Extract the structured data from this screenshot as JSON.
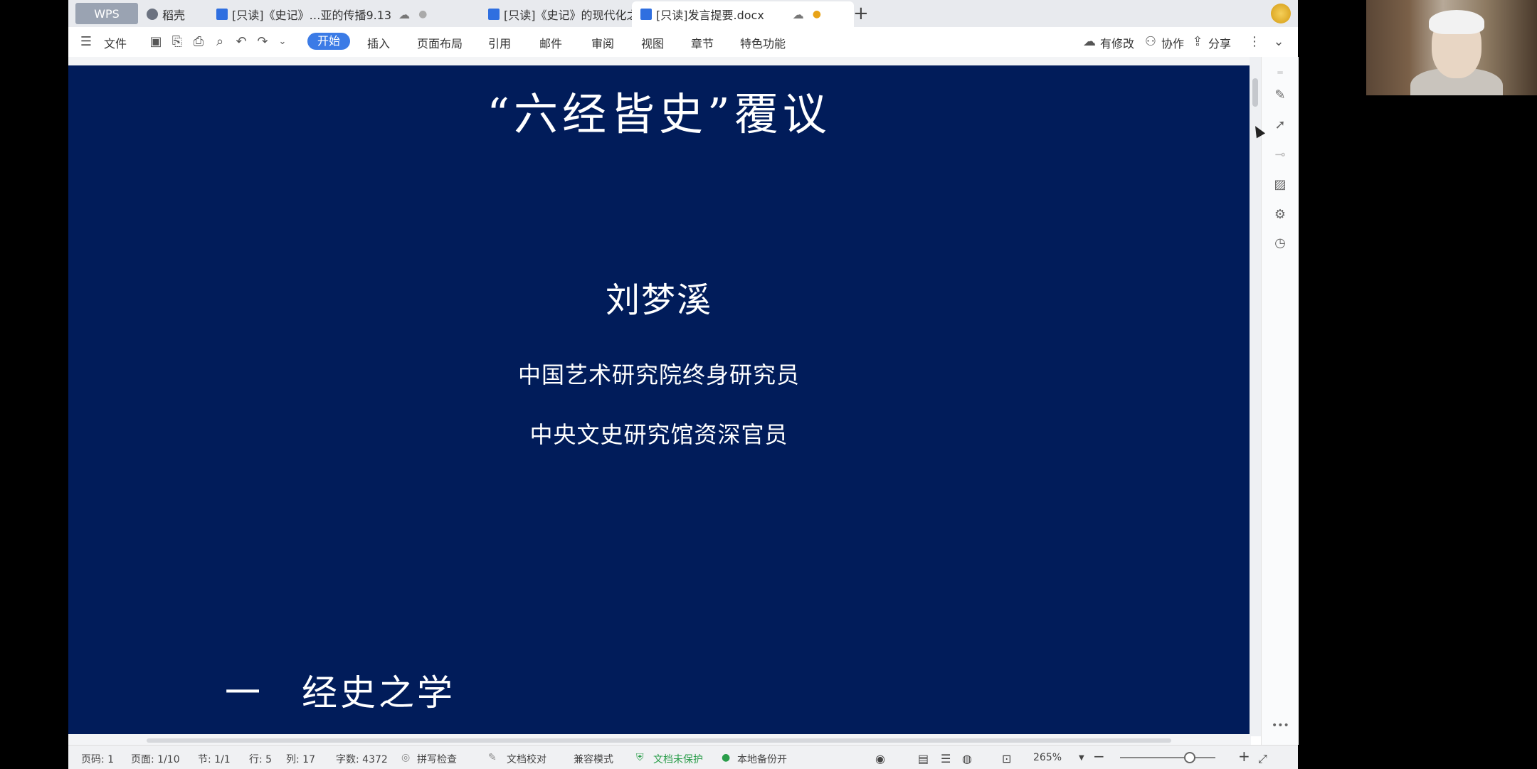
{
  "tabs": [
    {
      "label": "WPS"
    },
    {
      "label": "稻壳"
    },
    {
      "label": "[只读]《史记》…亚的传播9.13"
    },
    {
      "label": "[只读]《史记》的现代化之路"
    },
    {
      "label": "[只读]发言提要.docx"
    }
  ],
  "toolbar": {
    "file": "文件",
    "menus": [
      "开始",
      "插入",
      "页面布局",
      "引用",
      "邮件",
      "审阅",
      "视图",
      "章节",
      "特色功能"
    ],
    "right": {
      "modified": "有修改",
      "collab": "协作",
      "share": "分享"
    }
  },
  "document": {
    "title": "“六经皆史”覆议",
    "author": "刘梦溪",
    "affiliation1": "中国艺术研究院终身研究员",
    "affiliation2": "中央文史研究馆资深官员",
    "section_heading": "一　经史之学"
  },
  "status": {
    "page_code": "页码: 1",
    "page": "页面: 1/10",
    "section": "节: 1/1",
    "row": "行: 5",
    "col": "列: 17",
    "words": "字数: 4372",
    "spell": "拼写检查",
    "proof": "文档校对",
    "compat": "兼容模式",
    "unprotected": "文档未保护",
    "backup": "本地备份开",
    "zoom": "265%"
  },
  "colors": {
    "page_bg": "#011c5a",
    "accent": "#3b7be6"
  }
}
